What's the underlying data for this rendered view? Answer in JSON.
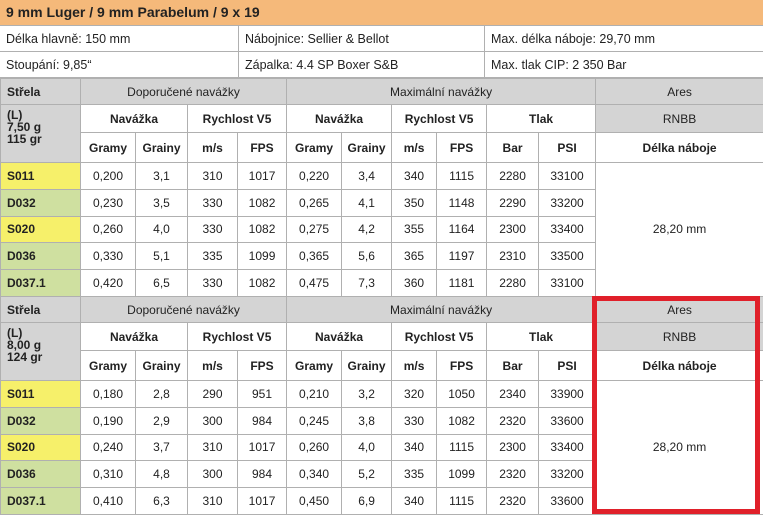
{
  "title": "9 mm Luger / 9 mm Parabelum / 9 x 19",
  "info": {
    "row1": [
      "Délka hlavně: 150 mm",
      "Nábojnice: Sellier & Bellot",
      "Max. délka náboje: 29,70 mm"
    ],
    "row2": [
      "Stoupání: 9,85“",
      "Zápalka: 4.4 SP Boxer S&B",
      "Max. tlak CIP: 2 350 Bar"
    ]
  },
  "headers": {
    "strela": "Střela",
    "doporucene": "Doporučené navážky",
    "maximalni": "Maximální navážky",
    "ares": "Ares",
    "navazka": "Navážka",
    "rychlost": "Rychlost V5",
    "tlak": "Tlak",
    "rnbb": "RNBB",
    "gramy": "Gramy",
    "grainy": "Grainy",
    "ms": "m/s",
    "fps": "FPS",
    "bar": "Bar",
    "psi": "PSI",
    "delka": "Délka náboje"
  },
  "sections": [
    {
      "bullet": [
        "(L)",
        "7,50 g",
        "115 gr"
      ],
      "length": "28,20 mm",
      "rows": [
        {
          "name": "S011",
          "color": "yellow",
          "vals": [
            "0,200",
            "3,1",
            "310",
            "1017",
            "0,220",
            "3,4",
            "340",
            "1115",
            "2280",
            "33100"
          ]
        },
        {
          "name": "D032",
          "color": "green",
          "vals": [
            "0,230",
            "3,5",
            "330",
            "1082",
            "0,265",
            "4,1",
            "350",
            "1148",
            "2290",
            "33200"
          ]
        },
        {
          "name": "S020",
          "color": "yellow",
          "vals": [
            "0,260",
            "4,0",
            "330",
            "1082",
            "0,275",
            "4,2",
            "355",
            "1164",
            "2300",
            "33400"
          ]
        },
        {
          "name": "D036",
          "color": "green",
          "vals": [
            "0,330",
            "5,1",
            "335",
            "1099",
            "0,365",
            "5,6",
            "365",
            "1197",
            "2310",
            "33500"
          ]
        },
        {
          "name": "D037.1",
          "color": "green",
          "vals": [
            "0,420",
            "6,5",
            "330",
            "1082",
            "0,475",
            "7,3",
            "360",
            "1181",
            "2280",
            "33100"
          ]
        }
      ]
    },
    {
      "bullet": [
        "(L)",
        "8,00 g",
        "124 gr"
      ],
      "length": "28,20 mm",
      "rows": [
        {
          "name": "S011",
          "color": "yellow",
          "vals": [
            "0,180",
            "2,8",
            "290",
            "951",
            "0,210",
            "3,2",
            "320",
            "1050",
            "2340",
            "33900"
          ]
        },
        {
          "name": "D032",
          "color": "green",
          "vals": [
            "0,190",
            "2,9",
            "300",
            "984",
            "0,245",
            "3,8",
            "330",
            "1082",
            "2320",
            "33600"
          ]
        },
        {
          "name": "S020",
          "color": "yellow",
          "vals": [
            "0,240",
            "3,7",
            "310",
            "1017",
            "0,260",
            "4,0",
            "340",
            "1115",
            "2300",
            "33400"
          ]
        },
        {
          "name": "D036",
          "color": "green",
          "vals": [
            "0,310",
            "4,8",
            "300",
            "984",
            "0,340",
            "5,2",
            "335",
            "1099",
            "2320",
            "33200"
          ]
        },
        {
          "name": "D037.1",
          "color": "green",
          "vals": [
            "0,410",
            "6,3",
            "310",
            "1017",
            "0,450",
            "6,9",
            "340",
            "1115",
            "2320",
            "33600"
          ]
        }
      ]
    }
  ],
  "highlight_color": "#e0202a"
}
